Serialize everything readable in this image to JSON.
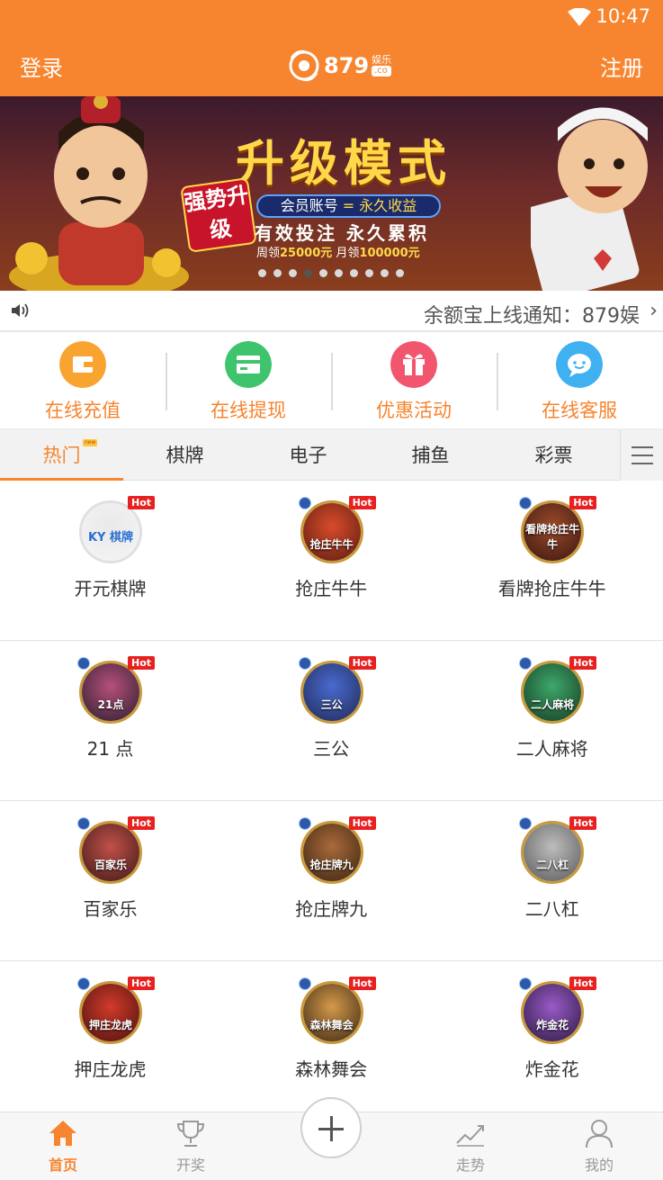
{
  "status_bar": {
    "time": "10:47"
  },
  "header": {
    "login": "登录",
    "register": "注册",
    "logo_number": "879",
    "logo_suffix": "娱乐",
    "logo_domain": ".co"
  },
  "banner": {
    "title": "升级模式",
    "tag": "强势升级",
    "member_text_a": "会员账号",
    "member_text_eq": "=",
    "member_text_b": "永久收益",
    "line": "有效投注 永久累积",
    "small_a": "周领",
    "small_a_val": "25000元",
    "small_b": "月领",
    "small_b_val": "100000元",
    "dot_count": 10,
    "active_dot": 3
  },
  "notice": {
    "text": "余额宝上线通知：879娱"
  },
  "quick_actions": [
    {
      "label": "在线充值",
      "icon": "wallet-icon",
      "color": "#f9a431"
    },
    {
      "label": "在线提现",
      "icon": "card-icon",
      "color": "#3ec46d"
    },
    {
      "label": "优惠活动",
      "icon": "gift-icon",
      "color": "#f2556e"
    },
    {
      "label": "在线客服",
      "icon": "chat-icon",
      "color": "#3fb0f0"
    }
  ],
  "tabs": [
    {
      "label": "热门",
      "active": true,
      "badge": "new"
    },
    {
      "label": "棋牌"
    },
    {
      "label": "电子"
    },
    {
      "label": "捕鱼"
    },
    {
      "label": "彩票"
    }
  ],
  "games": [
    {
      "name": "开元棋牌",
      "caption": "KY 棋牌",
      "hot": "Hot",
      "style": "ky"
    },
    {
      "name": "抢庄牛牛",
      "caption": "抢庄牛牛",
      "hot": "Hot",
      "style": "a"
    },
    {
      "name": "看牌抢庄牛牛",
      "caption": "看牌抢庄牛牛",
      "hot": "Hot",
      "style": "b"
    },
    {
      "name": "21 点",
      "caption": "21点",
      "hot": "Hot",
      "style": "c"
    },
    {
      "name": "三公",
      "caption": "三公",
      "hot": "Hot",
      "style": "d"
    },
    {
      "name": "二人麻将",
      "caption": "二人麻将",
      "hot": "Hot",
      "style": "e"
    },
    {
      "name": "百家乐",
      "caption": "百家乐",
      "hot": "Hot",
      "style": "f"
    },
    {
      "name": "抢庄牌九",
      "caption": "抢庄牌九",
      "hot": "Hot",
      "style": "g"
    },
    {
      "name": "二八杠",
      "caption": "二八杠",
      "hot": "Hot",
      "style": "gray"
    },
    {
      "name": "押庄龙虎",
      "caption": "押庄龙虎",
      "hot": "Hot",
      "style": "h"
    },
    {
      "name": "森林舞会",
      "caption": "森林舞会",
      "hot": "Hot",
      "style": "i"
    },
    {
      "name": "炸金花",
      "caption": "炸金花",
      "hot": "Hot",
      "style": "j"
    }
  ],
  "bottom_nav": [
    {
      "label": "首页",
      "icon": "home-icon",
      "active": true
    },
    {
      "label": "开奖",
      "icon": "trophy-icon"
    },
    {
      "label": "走势",
      "icon": "trend-icon"
    },
    {
      "label": "我的",
      "icon": "user-icon"
    }
  ],
  "colors": {
    "brand": "#f7842e",
    "hot": "#e8201f"
  }
}
